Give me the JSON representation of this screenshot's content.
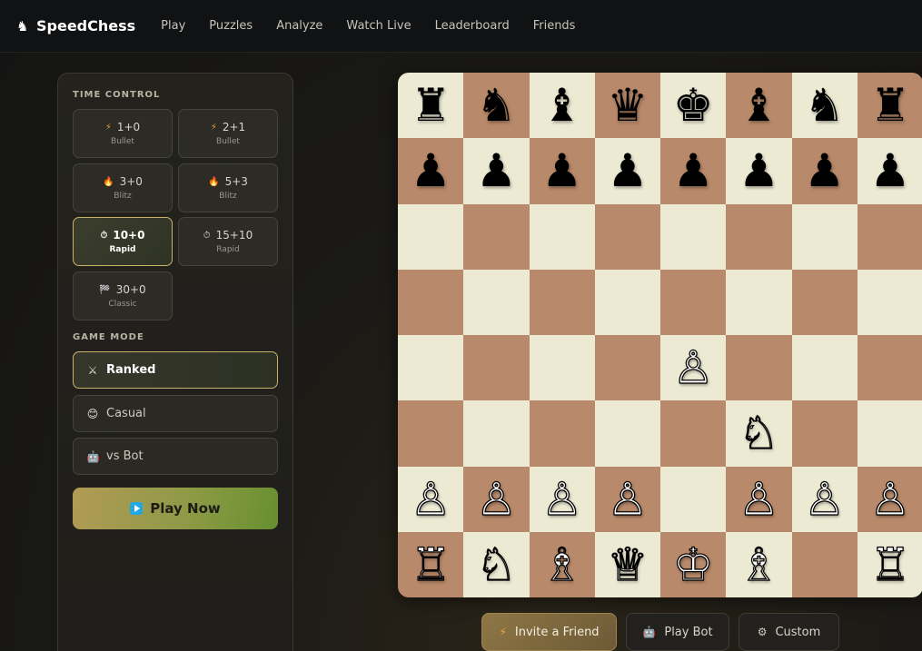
{
  "app": {
    "name": "SpeedChess",
    "logo_icon": "knight-icon"
  },
  "nav": {
    "links": [
      "Play",
      "Puzzles",
      "Analyze",
      "Watch Live",
      "Leaderboard",
      "Friends"
    ]
  },
  "sidebar": {
    "time_control_title": "TIME CONTROL",
    "time_controls": [
      {
        "time": "1+0",
        "category": "Bullet",
        "icon": "lightning-icon",
        "selected": false
      },
      {
        "time": "2+1",
        "category": "Bullet",
        "icon": "lightning-icon",
        "selected": false
      },
      {
        "time": "3+0",
        "category": "Blitz",
        "icon": "fire-icon",
        "selected": false
      },
      {
        "time": "5+3",
        "category": "Blitz",
        "icon": "fire-icon",
        "selected": false
      },
      {
        "time": "10+0",
        "category": "Rapid",
        "icon": "stopwatch-icon",
        "selected": true
      },
      {
        "time": "15+10",
        "category": "Rapid",
        "icon": "stopwatch-icon",
        "selected": false
      },
      {
        "time": "30+0",
        "category": "Classic",
        "icon": "checkered-flag-icon",
        "selected": false
      }
    ],
    "game_mode_title": "GAME MODE",
    "game_modes": [
      {
        "label": "Ranked",
        "icon": "crossed-swords-icon",
        "selected": true
      },
      {
        "label": "Casual",
        "icon": "smiley-icon",
        "selected": false
      },
      {
        "label": "vs Bot",
        "icon": "robot-icon",
        "selected": false
      }
    ],
    "play_button": {
      "label": "Play Now",
      "icon": "play-icon"
    }
  },
  "board": {
    "ranks": [
      [
        "♜",
        "♞",
        "♝",
        "♛",
        "♚",
        "♝",
        "♞",
        "♜"
      ],
      [
        "♟",
        "♟",
        "♟",
        "♟",
        "♟",
        "♟",
        "♟",
        "♟"
      ],
      [
        "",
        "",
        "",
        "",
        "",
        "",
        "",
        ""
      ],
      [
        "",
        "",
        "",
        "",
        "",
        "",
        "",
        ""
      ],
      [
        "",
        "",
        "",
        "",
        "♙",
        "",
        "",
        ""
      ],
      [
        "",
        "",
        "",
        "",
        "",
        "♘",
        "",
        ""
      ],
      [
        "♙",
        "♙",
        "♙",
        "♙",
        "",
        "♙",
        "♙",
        "♙"
      ],
      [
        "♖",
        "♘",
        "♗",
        "♕",
        "♔",
        "♗",
        "",
        "♖"
      ]
    ],
    "light_color": "#ecead3",
    "dark_color": "#b8896a"
  },
  "actions": {
    "invite": {
      "label": "Invite a Friend",
      "icon": "lightning-icon"
    },
    "bot": {
      "label": "Play Bot",
      "icon": "robot-icon"
    },
    "custom": {
      "label": "Custom",
      "icon": "gear-icon"
    }
  }
}
